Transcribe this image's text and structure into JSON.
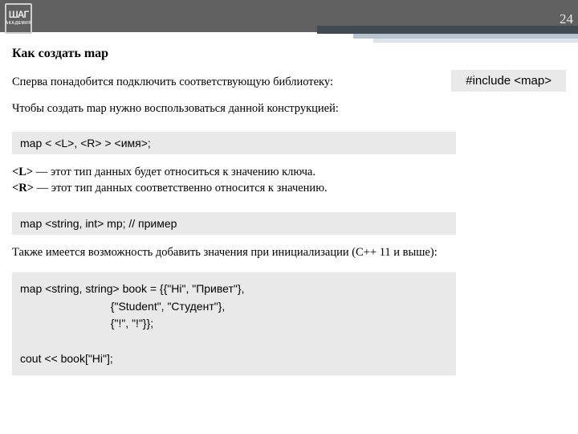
{
  "page_number": "24",
  "logo": {
    "line1": "ШАГ",
    "line2": "АКАДЕМИЯ"
  },
  "title": "Как создать map",
  "para_include": "Сперва понадобится подключить соответствующую библиотеку:",
  "include_code": "#include <map>",
  "para_construct": "Чтобы создать map нужно воспользоваться данной конструкцией:",
  "decl_code": "map < <L>, <R> > <имя>;",
  "desc_L_tag": "<L>",
  "desc_L_rest": " — этот тип данных будет относиться к значению ключа.",
  "desc_R_tag": "<R>",
  "desc_R_rest": " — этот тип данных соответственно относится к значению.",
  "example_code": "map <string, int> mp; // пример",
  "para_init": "Также имеется возможность добавить значения при инициализации (C++ 11 и выше):",
  "init_code": "map <string, string> book = {{\"Hi\", \"Привет\"},\n                             {\"Student\", \"Студент\"},\n                             {\"!\", \"!\"}};\n\ncout << book[\"Hi\"];"
}
